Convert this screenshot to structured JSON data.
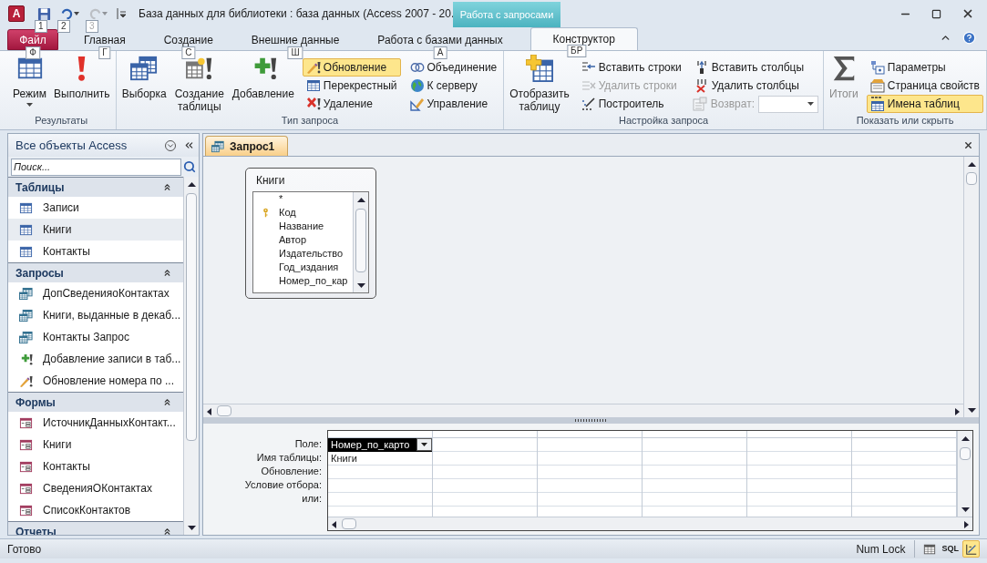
{
  "title_bar": {
    "app_icon": "A",
    "quick_access": [
      {
        "keytip": "1",
        "disabled": false
      },
      {
        "keytip": "2",
        "disabled": false
      },
      {
        "keytip": "3",
        "disabled": true
      }
    ],
    "title": "База данных для библиотеки : база данных (Access 2007 - 20...",
    "context_group": "Работа с запросами"
  },
  "ribbon_tabs": [
    {
      "label": "Файл",
      "keytip": "Ф",
      "kind": "file",
      "selected": false
    },
    {
      "label": "Главная",
      "keytip": "Г",
      "kind": "tab",
      "selected": false
    },
    {
      "label": "Создание",
      "keytip": "С",
      "kind": "tab",
      "selected": false
    },
    {
      "label": "Внешние данные",
      "keytip": "Ш",
      "kind": "tab",
      "selected": false
    },
    {
      "label": "Работа с базами данных",
      "keytip": "А",
      "kind": "tab",
      "selected": false
    },
    {
      "label": "Конструктор",
      "keytip": "БР",
      "kind": "context",
      "selected": true
    }
  ],
  "ribbon_groups": [
    {
      "label": "Результаты",
      "items": [
        {
          "kind": "large",
          "label": "Режим",
          "dropdown": true,
          "disabled": false
        },
        {
          "kind": "large",
          "label": "Выполнить",
          "dropdown": false,
          "disabled": false
        }
      ]
    },
    {
      "label": "Тип запроса",
      "items": [
        {
          "kind": "large",
          "label": "Выборка",
          "dropdown": false,
          "disabled": false
        },
        {
          "kind": "large",
          "label": "Создание таблицы",
          "dropdown": false,
          "disabled": false
        },
        {
          "kind": "large",
          "label": "Добавление",
          "dropdown": false,
          "disabled": false
        },
        {
          "kind": "stack",
          "buttons": [
            {
              "kind": "button",
              "label": "Обновление",
              "selected": true,
              "disabled": false
            },
            {
              "kind": "button",
              "label": "Перекрестный",
              "selected": false,
              "disabled": false
            },
            {
              "kind": "button",
              "label": "Удаление",
              "selected": false,
              "disabled": false
            }
          ]
        },
        {
          "kind": "stack",
          "buttons": [
            {
              "kind": "button",
              "label": "Объединение",
              "selected": false,
              "disabled": false
            },
            {
              "kind": "button",
              "label": "К серверу",
              "selected": false,
              "disabled": false
            },
            {
              "kind": "button",
              "label": "Управление",
              "selected": false,
              "disabled": false
            }
          ]
        }
      ]
    },
    {
      "label": "Настройка запроса",
      "items": [
        {
          "kind": "large",
          "label": "Отобразить таблицу",
          "dropdown": false,
          "disabled": false
        },
        {
          "kind": "stack",
          "buttons": [
            {
              "kind": "button",
              "label": "Вставить строки",
              "selected": false,
              "disabled": false
            },
            {
              "kind": "button",
              "label": "Удалить строки",
              "selected": false,
              "disabled": true
            },
            {
              "kind": "button",
              "label": "Построитель",
              "selected": false,
              "disabled": false
            }
          ]
        },
        {
          "kind": "stack",
          "buttons": [
            {
              "kind": "button",
              "label": "Вставить столбцы",
              "selected": false,
              "disabled": false
            },
            {
              "kind": "button",
              "label": "Удалить столбцы",
              "selected": false,
              "disabled": false
            },
            {
              "kind": "combo",
              "label": "Возврат:",
              "disabled": true
            }
          ]
        }
      ]
    },
    {
      "label": "Показать или скрыть",
      "items": [
        {
          "kind": "large",
          "label": "Итоги",
          "dropdown": false,
          "disabled": true
        },
        {
          "kind": "stack",
          "buttons": [
            {
              "kind": "button",
              "label": "Параметры",
              "selected": false,
              "disabled": false
            },
            {
              "kind": "button",
              "label": "Страница свойств",
              "selected": false,
              "disabled": false
            },
            {
              "kind": "button",
              "label": "Имена таблиц",
              "selected": true,
              "disabled": false
            }
          ]
        }
      ]
    }
  ],
  "nav_pane": {
    "title": "Все объекты Access",
    "search": {
      "placeholder": "Поиск..."
    },
    "groups": [
      {
        "label": "Таблицы",
        "items": [
          {
            "label": "Записи",
            "kind": "table",
            "selected": false
          },
          {
            "label": "Книги",
            "kind": "table",
            "selected": true
          },
          {
            "label": "Контакты",
            "kind": "table",
            "selected": false
          }
        ]
      },
      {
        "label": "Запросы",
        "items": [
          {
            "label": "ДопСведенияоКонтактах",
            "kind": "query",
            "selected": false
          },
          {
            "label": "Книги, выданные в декаб...",
            "kind": "query",
            "selected": false
          },
          {
            "label": "Контакты Запрос",
            "kind": "query",
            "selected": false
          },
          {
            "label": "Добавление записи в таб...",
            "kind": "append",
            "selected": false
          },
          {
            "label": "Обновление номера по ...",
            "kind": "update",
            "selected": false
          }
        ]
      },
      {
        "label": "Формы",
        "items": [
          {
            "label": "ИсточникДанныхКонтакт...",
            "kind": "form",
            "selected": false
          },
          {
            "label": "Книги",
            "kind": "form",
            "selected": false
          },
          {
            "label": "Контакты",
            "kind": "form",
            "selected": false
          },
          {
            "label": "СведенияОКонтактах",
            "kind": "form",
            "selected": false
          },
          {
            "label": "СписокКонтактов",
            "kind": "form",
            "selected": false
          }
        ]
      },
      {
        "label": "Отчеты"
      }
    ]
  },
  "document": {
    "tab": "Запрос1",
    "table_box": {
      "title": "Книги",
      "fields": [
        {
          "label": "*",
          "key": false
        },
        {
          "label": "Код",
          "key": true
        },
        {
          "label": "Название",
          "key": false
        },
        {
          "label": "Автор",
          "key": false
        },
        {
          "label": "Издательство",
          "key": false
        },
        {
          "label": "Год_издания",
          "key": false
        },
        {
          "label": "Номер_по_кар",
          "key": false
        }
      ]
    },
    "grid": {
      "row_labels": [
        "Поле:",
        "Имя таблицы:",
        "Обновление:",
        "Условие отбора:",
        "или:"
      ],
      "columns": [
        {
          "field": "Номер_по_карто",
          "table": "Книги",
          "selected": true
        }
      ]
    }
  },
  "status_bar": {
    "text": "Готово",
    "indicator": "Num Lock",
    "views": [
      {
        "kind": "datasheet",
        "selected": false
      },
      {
        "kind": "sql",
        "label": "SQL",
        "selected": false
      },
      {
        "kind": "design",
        "selected": true
      }
    ]
  }
}
